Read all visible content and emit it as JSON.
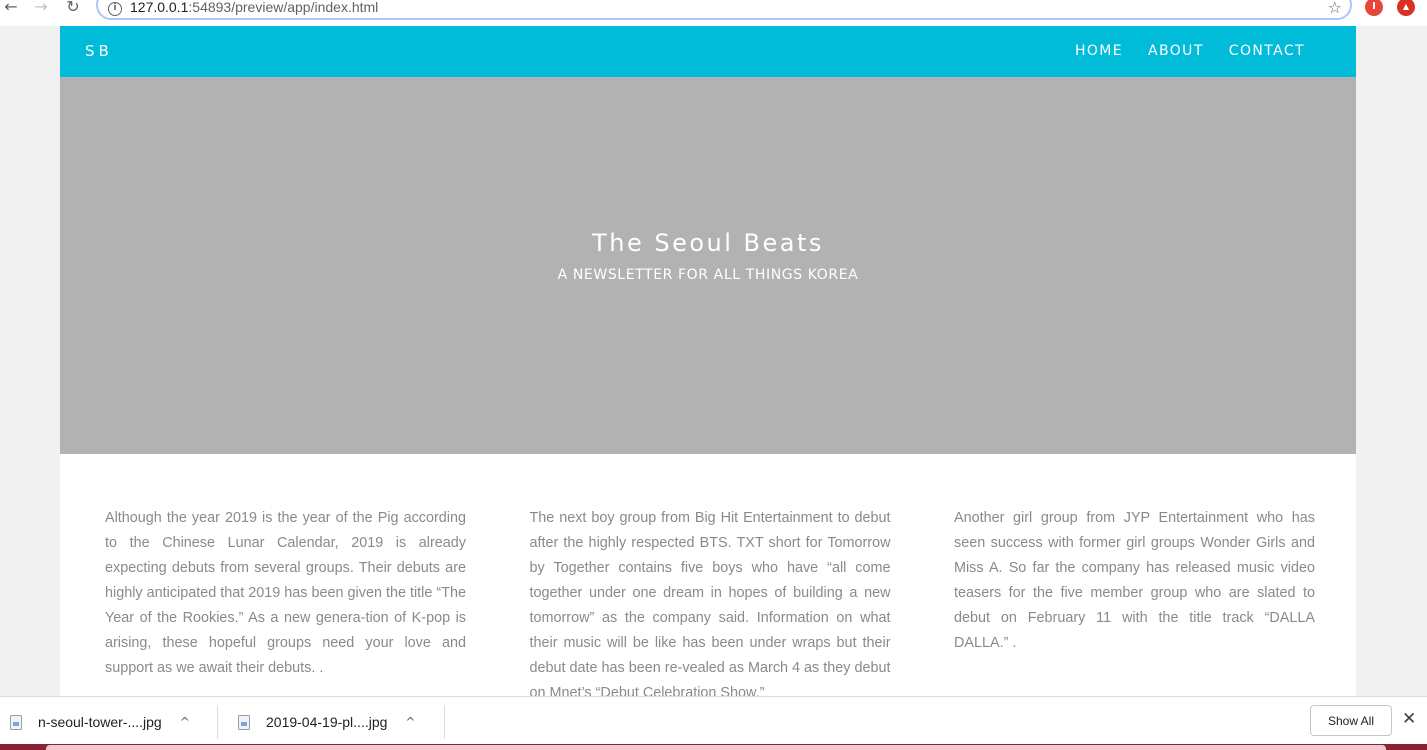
{
  "browser": {
    "back_icon": "←",
    "forward_icon": "→",
    "reload_icon": "↻",
    "url_host": "127.0.0.1",
    "url_rest": ":54893/preview/app/index.html",
    "star_icon": "☆",
    "ext1_label": "I",
    "ext2_label": "▲"
  },
  "site": {
    "brand": "SB",
    "nav": [
      "HOME",
      "ABOUT",
      "CONTACT"
    ],
    "hero_title": "The Seoul Beats",
    "hero_subtitle": "A NEWSLETTER FOR ALL THINGS KOREA",
    "columns": [
      "Although the year 2019 is the year of the Pig according to the Chinese Lunar Calendar, 2019 is already expecting debuts from several groups. Their debuts are highly anticipated that 2019 has been given the title “The Year of the Rookies.” As a new genera-tion of K-pop is arising, these hopeful groups need your love and support as we await their debuts. .",
      "The next boy group from Big Hit Entertainment to debut after the highly respected BTS. TXT short for Tomorrow by Together contains five boys who have “all come together under one dream in hopes of building a new tomorrow” as the company said. Information on what their music will be like has been under wraps but their debut date has been re-vealed as March 4 as they debut on Mnet’s “Debut Celebration Show.”",
      "Another girl group from JYP Entertainment who has seen success with former girl groups Wonder Girls and Miss A. So far the company has released music video teasers for the five member group who are slated to debut on February 11 with the title track “DALLA DALLA.” ."
    ]
  },
  "downloads": {
    "items": [
      {
        "name": "n-seoul-tower-....jpg"
      },
      {
        "name": "2019-04-19-pl....jpg"
      }
    ],
    "chevron_icon": "^",
    "show_all": "Show All",
    "close_icon": "✕"
  },
  "colors": {
    "nav_bg": "#00bcd9",
    "hero_bg": "#b2b2b2",
    "body_text": "#8a8a8a"
  }
}
